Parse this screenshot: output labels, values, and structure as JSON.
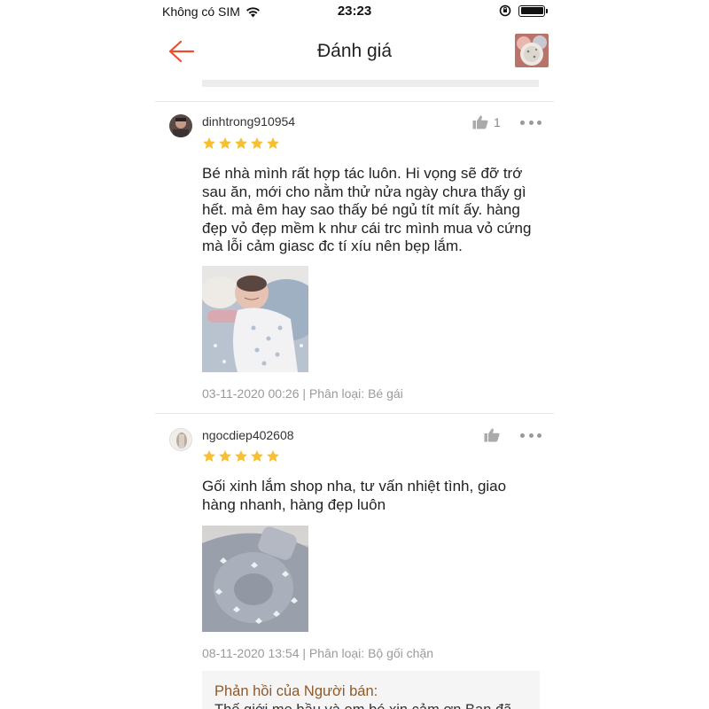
{
  "status_bar": {
    "carrier": "Không có SIM",
    "time": "23:23"
  },
  "header": {
    "title": "Đánh giá",
    "back_icon": "arrow-left-icon",
    "accent_color": "#ee4d2d"
  },
  "reviews": [
    {
      "username": "dinhtrong910954",
      "rating": 5,
      "like_count": "1",
      "text_lines": [
        "Bé nhà mình rất hợp tác luôn. Hi vọng sẽ đỡ trớ",
        "sau ăn, mới cho nằm thử nửa ngày chưa thấy gì",
        "hết. mà êm hay sao thấy bé ngủ tít mít ấy. hàng",
        "đẹp vỏ đẹp mềm k như cái trc mình mua vỏ cứng",
        "mà lỗi cảm giasc đc tí xíu nên bẹp lắm."
      ],
      "meta": "03-11-2020 00:26 | Phân loại: Bé gái"
    },
    {
      "username": "ngocdiep402608",
      "rating": 5,
      "like_count": "",
      "text_lines": [
        "Gối xinh lắm shop nha, tư vấn nhiệt tình, giao",
        "hàng nhanh, hàng đẹp luôn"
      ],
      "meta": "08-11-2020 13:54 | Phân loại: Bộ gối chặn"
    }
  ],
  "seller_reply": {
    "label": "Phản hồi của Người bán:",
    "text": "Thế giới mẹ bầu và em bé xin cảm ơn Bạn đã"
  },
  "colors": {
    "star": "#f6c032",
    "seller_label": "#8d5a2b"
  }
}
